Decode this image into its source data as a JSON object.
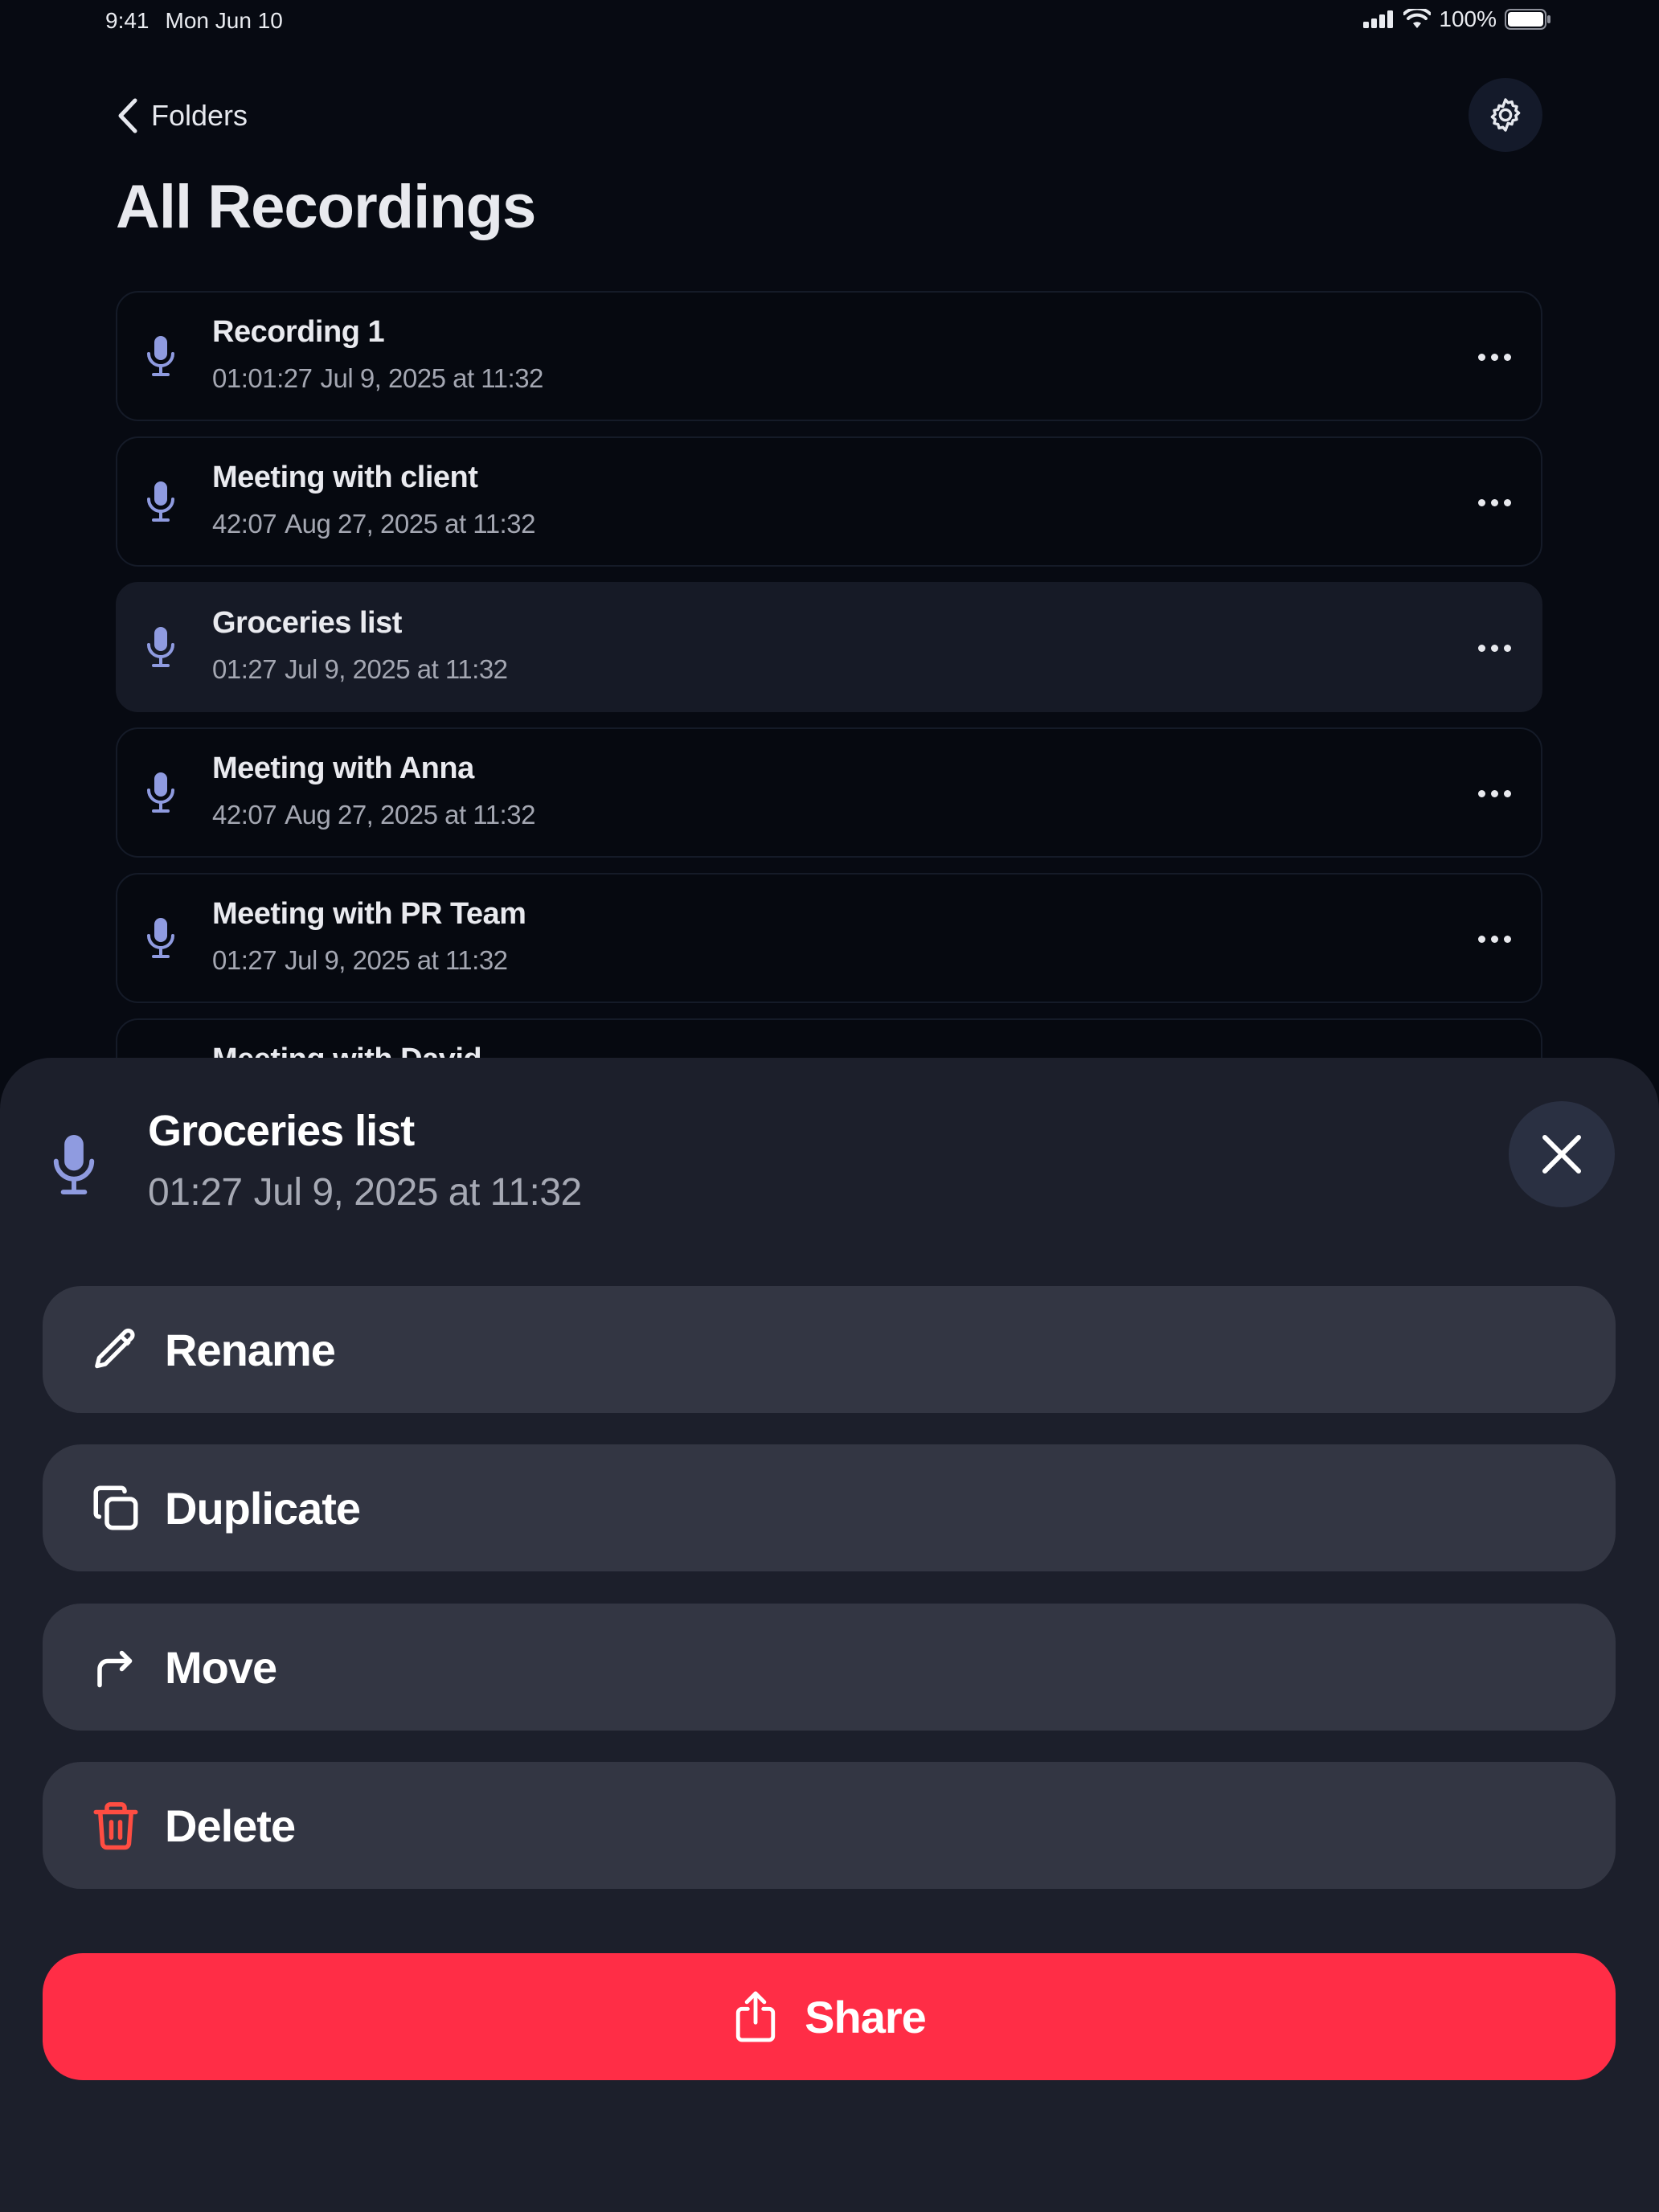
{
  "status_bar": {
    "time": "9:41",
    "date": "Mon Jun 10",
    "battery": "100%",
    "icons": [
      "signal-icon",
      "wifi-icon",
      "battery-icon"
    ]
  },
  "nav": {
    "back_label": "Folders",
    "back_icon": "chevron-left-icon",
    "settings_icon": "gear-icon"
  },
  "page": {
    "title": "All Recordings"
  },
  "recordings": [
    {
      "title": "Recording 1",
      "duration": "01:01:27",
      "date": "Jul 9, 2025 at 11:32"
    },
    {
      "title": "Meeting with client",
      "duration": "42:07",
      "date": "Aug 27, 2025 at 11:32"
    },
    {
      "title": "Groceries list",
      "duration": "01:27",
      "date": "Jul 9, 2025 at 11:32",
      "selected": true
    },
    {
      "title": "Meeting with Anna",
      "duration": "42:07",
      "date": "Aug 27, 2025 at 11:32"
    },
    {
      "title": "Meeting with PR Team",
      "duration": "01:27",
      "date": "Jul 9, 2025 at 11:32"
    },
    {
      "title": "Meeting with David",
      "duration": "",
      "date": ""
    }
  ],
  "sheet": {
    "title": "Groceries list",
    "duration": "01:27",
    "date": "Jul 9, 2025 at 11:32",
    "actions": [
      {
        "label": "Rename",
        "icon": "pencil-icon"
      },
      {
        "label": "Duplicate",
        "icon": "duplicate-icon"
      },
      {
        "label": "Move",
        "icon": "move-arrow-icon"
      },
      {
        "label": "Delete",
        "icon": "trash-icon"
      }
    ],
    "share_label": "Share",
    "share_icon": "share-icon"
  },
  "colors": {
    "background": "#070a12",
    "sheet": "#1c1f2b",
    "action_button": "#333643",
    "accent_red": "#ff2d46",
    "delete_icon": "#ff4d42",
    "mic_icon": "#8f9be0"
  }
}
